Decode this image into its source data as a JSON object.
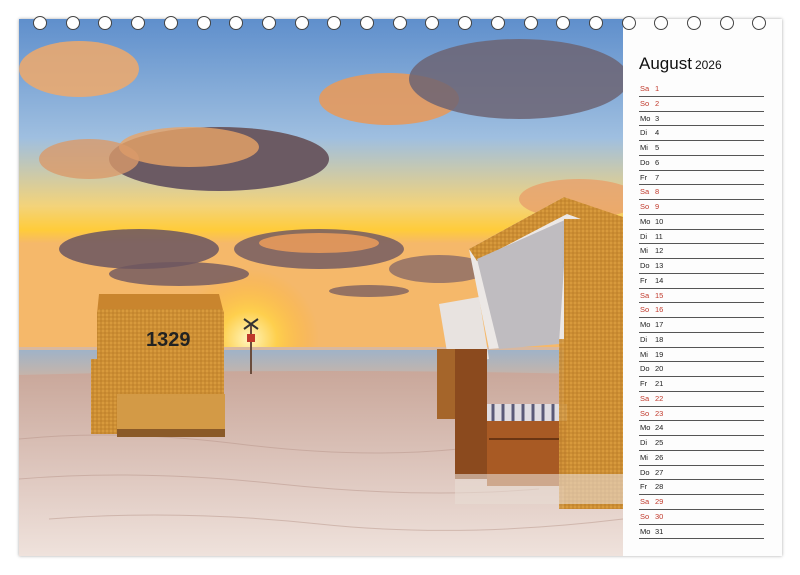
{
  "month": {
    "name": "August",
    "year": "2026"
  },
  "days": [
    {
      "d": "Sa",
      "n": "1",
      "we": true
    },
    {
      "d": "So",
      "n": "2",
      "we": true
    },
    {
      "d": "Mo",
      "n": "3",
      "we": false
    },
    {
      "d": "Di",
      "n": "4",
      "we": false
    },
    {
      "d": "Mi",
      "n": "5",
      "we": false
    },
    {
      "d": "Do",
      "n": "6",
      "we": false
    },
    {
      "d": "Fr",
      "n": "7",
      "we": false
    },
    {
      "d": "Sa",
      "n": "8",
      "we": true
    },
    {
      "d": "So",
      "n": "9",
      "we": true
    },
    {
      "d": "Mo",
      "n": "10",
      "we": false
    },
    {
      "d": "Di",
      "n": "11",
      "we": false
    },
    {
      "d": "Mi",
      "n": "12",
      "we": false
    },
    {
      "d": "Do",
      "n": "13",
      "we": false
    },
    {
      "d": "Fr",
      "n": "14",
      "we": false
    },
    {
      "d": "Sa",
      "n": "15",
      "we": true
    },
    {
      "d": "So",
      "n": "16",
      "we": true
    },
    {
      "d": "Mo",
      "n": "17",
      "we": false
    },
    {
      "d": "Di",
      "n": "18",
      "we": false
    },
    {
      "d": "Mi",
      "n": "19",
      "we": false
    },
    {
      "d": "Do",
      "n": "20",
      "we": false
    },
    {
      "d": "Fr",
      "n": "21",
      "we": false
    },
    {
      "d": "Sa",
      "n": "22",
      "we": true
    },
    {
      "d": "So",
      "n": "23",
      "we": true
    },
    {
      "d": "Mo",
      "n": "24",
      "we": false
    },
    {
      "d": "Di",
      "n": "25",
      "we": false
    },
    {
      "d": "Mi",
      "n": "26",
      "we": false
    },
    {
      "d": "Do",
      "n": "27",
      "we": false
    },
    {
      "d": "Fr",
      "n": "28",
      "we": false
    },
    {
      "d": "Sa",
      "n": "29",
      "we": true
    },
    {
      "d": "So",
      "n": "30",
      "we": true
    },
    {
      "d": "Mo",
      "n": "31",
      "we": false
    }
  ],
  "photo": {
    "chair_number": "1329"
  },
  "colors": {
    "weekend": "#c0392b",
    "weekday": "#222222",
    "sand": "#d9c2b8",
    "sky_top": "#6f9bd0",
    "sun": "#ffd24a"
  }
}
